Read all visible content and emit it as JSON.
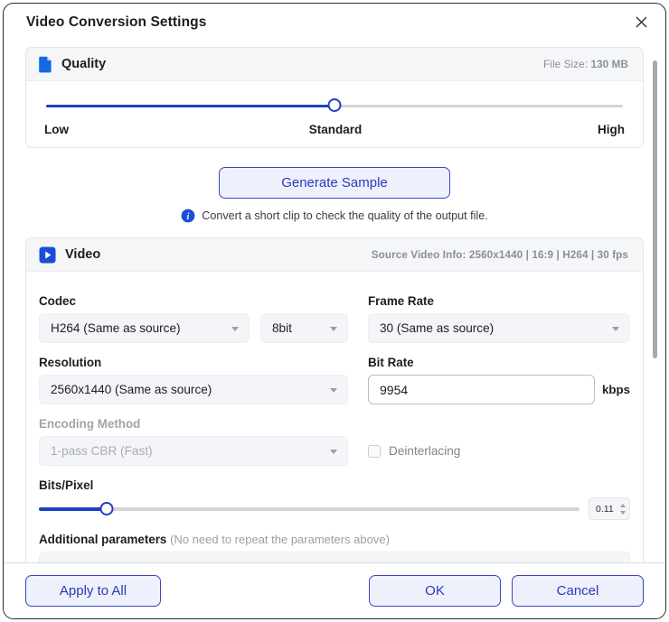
{
  "dialog": {
    "title": "Video Conversion Settings",
    "close_icon": "close-icon"
  },
  "quality": {
    "header_title": "Quality",
    "header_icon": "file-icon",
    "file_size_label": "File Size:",
    "file_size_value": "130 MB",
    "slider": {
      "low_label": "Low",
      "standard_label": "Standard",
      "high_label": "High",
      "position_percent": 50
    },
    "generate_sample_label": "Generate Sample",
    "info_icon": "info-icon",
    "note": "Convert a short clip to check the quality of the output file."
  },
  "video": {
    "header_title": "Video",
    "header_icon": "play-icon",
    "source_info": "Source Video Info: 2560x1440 | 16:9 | H264 | 30 fps",
    "codec": {
      "label": "Codec",
      "value": "H264 (Same as source)",
      "depth_value": "8bit"
    },
    "frame_rate": {
      "label": "Frame Rate",
      "value": "30 (Same as source)"
    },
    "resolution": {
      "label": "Resolution",
      "value": "2560x1440 (Same as source)"
    },
    "bit_rate": {
      "label": "Bit Rate",
      "value": "9954",
      "placeholder": "",
      "unit": "kbps"
    },
    "encoding_method": {
      "label": "Encoding Method",
      "value": "1-pass CBR (Fast)"
    },
    "deinterlacing": {
      "label": "Deinterlacing",
      "checked": false
    },
    "bits_pixel": {
      "label": "Bits/Pixel",
      "value": "0.11",
      "position_percent": 12.5
    },
    "additional_parameters": {
      "label": "Additional parameters",
      "note": "(No need to repeat the parameters above)",
      "value": "",
      "placeholder": ""
    }
  },
  "footer": {
    "apply_to_all_label": "Apply to All",
    "ok_label": "OK",
    "cancel_label": "Cancel"
  },
  "colors": {
    "accent_blue": "#1d3fc4",
    "button_border": "#3a47b8",
    "button_fill": "#eef0fb",
    "muted_text": "#8a8f98"
  }
}
